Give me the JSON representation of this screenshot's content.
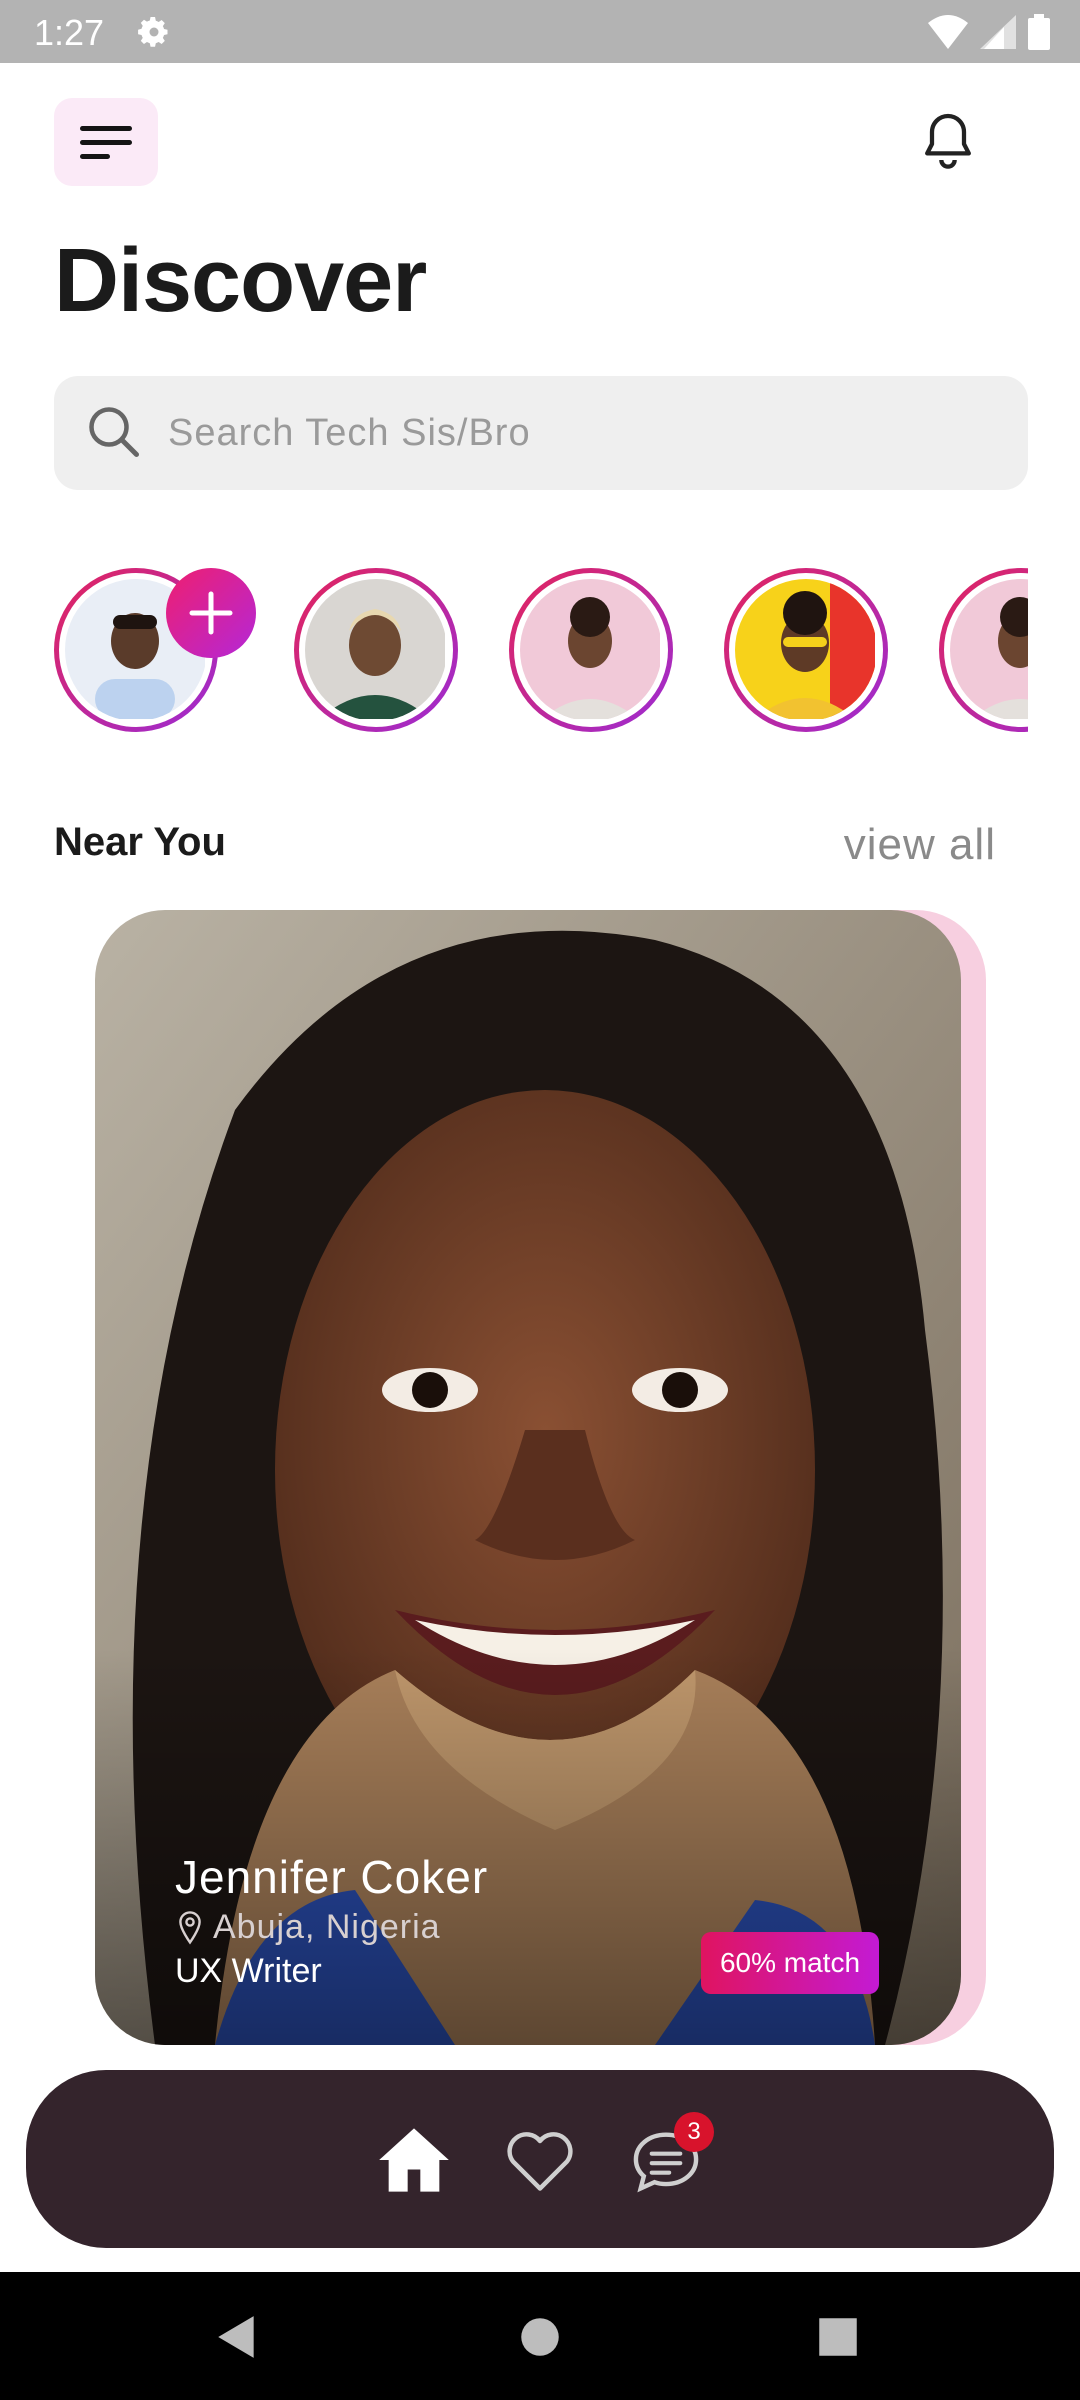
{
  "status_bar": {
    "time": "1:27"
  },
  "header": {
    "title": "Discover"
  },
  "search": {
    "placeholder": "Search Tech Sis/Bro"
  },
  "stories": [
    {
      "name": "my-story",
      "add": true
    },
    {
      "name": "story-2"
    },
    {
      "name": "story-3"
    },
    {
      "name": "story-4"
    },
    {
      "name": "story-5"
    }
  ],
  "near_you": {
    "title": "Near You",
    "view_all": "view all",
    "card": {
      "name": "Jennifer Coker",
      "location": "Abuja, Nigeria",
      "role": "UX Writer",
      "match": "60% match"
    }
  },
  "bottom_nav": {
    "items": [
      "home",
      "favorites",
      "messages"
    ],
    "messages_badge": "3"
  },
  "colors": {
    "accent_gradient_start": "#e4245a",
    "accent_gradient_end": "#9b2bd6",
    "nav_background": "#34242c",
    "badge": "#d8132c"
  }
}
